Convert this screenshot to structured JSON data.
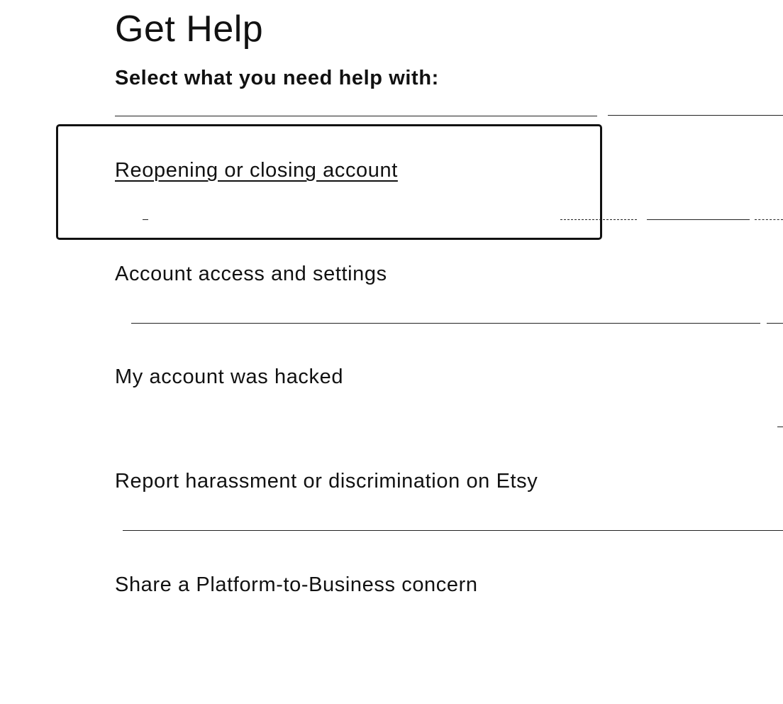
{
  "header": {
    "title": "Get Help",
    "subtitle": "Select what you need help with:"
  },
  "help_options": [
    {
      "label": "Reopening or closing account",
      "selected": true
    },
    {
      "label": "Account access and settings",
      "selected": false
    },
    {
      "label": "My account was hacked",
      "selected": false
    },
    {
      "label": "Report harassment or discrimination on Etsy",
      "selected": false
    },
    {
      "label": "Share a Platform-to-Business concern",
      "selected": false
    }
  ],
  "colors": {
    "text": "#111111",
    "background": "#ffffff",
    "focus_outline": "#111111"
  }
}
